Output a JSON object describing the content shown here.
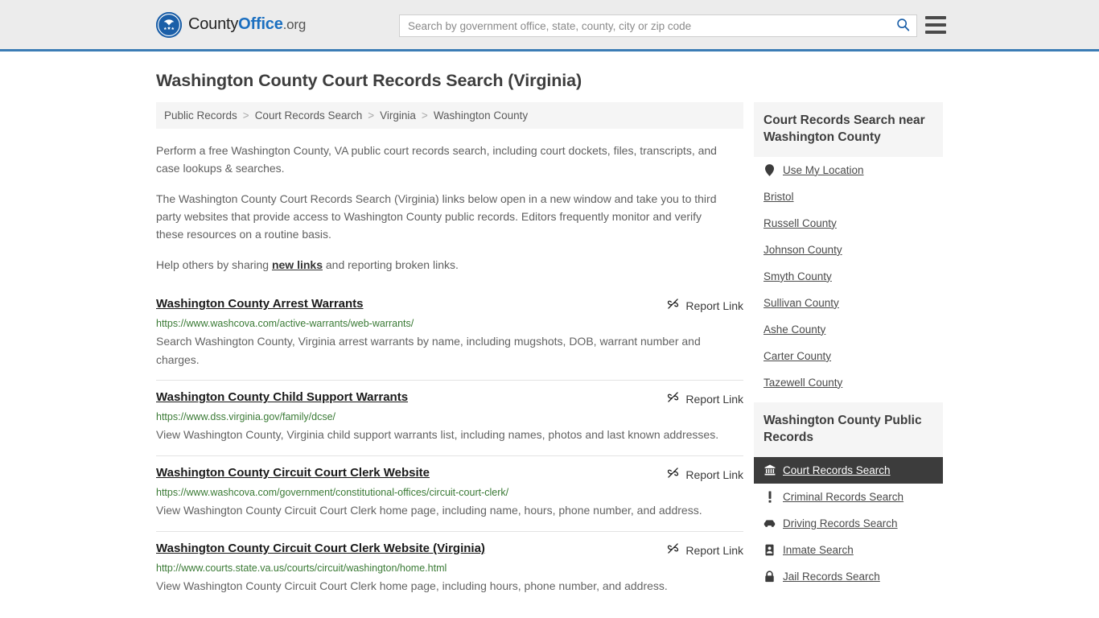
{
  "header": {
    "logo": {
      "icon": "eagle-seal-icon",
      "text_part1": "County",
      "text_part2": "Office",
      "text_part3": ".org"
    },
    "search": {
      "placeholder": "Search by government office, state, county, city or zip code",
      "value": "",
      "icon": "search-icon"
    },
    "menu_icon": "hamburger-menu-icon"
  },
  "page_title": "Washington County Court Records Search (Virginia)",
  "breadcrumb": {
    "separator": ">",
    "items": [
      {
        "label": "Public Records"
      },
      {
        "label": "Court Records Search"
      },
      {
        "label": "Virginia"
      },
      {
        "label": "Washington County"
      }
    ]
  },
  "intro": {
    "p1": "Perform a free Washington County, VA public court records search, including court dockets, files, transcripts, and case lookups & searches.",
    "p2": "The Washington County Court Records Search (Virginia) links below open in a new window and take you to third party websites that provide access to Washington County public records. Editors frequently monitor and verify these resources on a routine basis.",
    "p3_before": "Help others by sharing ",
    "p3_link": "new links",
    "p3_after": " and reporting broken links."
  },
  "report_link_label": "Report Link",
  "report_link_icon": "broken-link-icon",
  "results": [
    {
      "title": "Washington County Arrest Warrants",
      "url": "https://www.washcova.com/active-warrants/web-warrants/",
      "description": "Search Washington County, Virginia arrest warrants by name, including mugshots, DOB, warrant number and charges."
    },
    {
      "title": "Washington County Child Support Warrants",
      "url": "https://www.dss.virginia.gov/family/dcse/",
      "description": "View Washington County, Virginia child support warrants list, including names, photos and last known addresses."
    },
    {
      "title": "Washington County Circuit Court Clerk Website",
      "url": "https://www.washcova.com/government/constitutional-offices/circuit-court-clerk/",
      "description": "View Washington County Circuit Court Clerk home page, including name, hours, phone number, and address."
    },
    {
      "title": "Washington County Circuit Court Clerk Website (Virginia)",
      "url": "http://www.courts.state.va.us/courts/circuit/washington/home.html",
      "description": "View Washington County Circuit Court Clerk home page, including hours, phone number, and address."
    }
  ],
  "sidebar": {
    "nearby": {
      "heading": "Court Records Search near Washington County",
      "items": [
        {
          "label": "Use My Location",
          "icon": "map-pin-icon"
        },
        {
          "label": "Bristol",
          "icon": null
        },
        {
          "label": "Russell County",
          "icon": null
        },
        {
          "label": "Johnson County",
          "icon": null
        },
        {
          "label": "Smyth County",
          "icon": null
        },
        {
          "label": "Sullivan County",
          "icon": null
        },
        {
          "label": "Ashe County",
          "icon": null
        },
        {
          "label": "Carter County",
          "icon": null
        },
        {
          "label": "Tazewell County",
          "icon": null
        }
      ]
    },
    "public_records": {
      "heading": "Washington County Public Records",
      "items": [
        {
          "label": "Court Records Search",
          "icon": "courthouse-icon",
          "active": true
        },
        {
          "label": "Criminal Records Search",
          "icon": "exclamation-icon",
          "active": false
        },
        {
          "label": "Driving Records Search",
          "icon": "car-icon",
          "active": false
        },
        {
          "label": "Inmate Search",
          "icon": "id-badge-icon",
          "active": false
        },
        {
          "label": "Jail Records Search",
          "icon": "lock-icon",
          "active": false
        }
      ]
    }
  },
  "colors": {
    "brand_blue": "#1b5fa8",
    "header_bg": "#ececec",
    "header_border": "#3b7cb5",
    "url_green": "#3a7a35",
    "active_bg": "#3c3c3c"
  }
}
